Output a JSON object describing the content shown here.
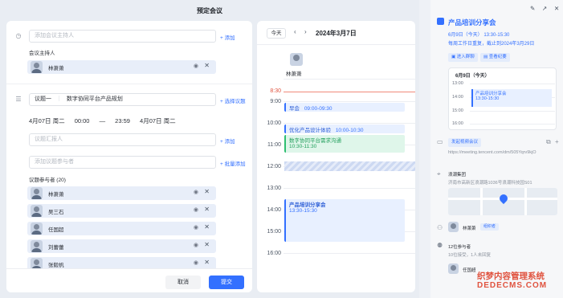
{
  "dialog": {
    "title": "预定会议"
  },
  "form": {
    "host_placeholder": "添加会议主持人",
    "add_label": "添加",
    "host_section_label": "会议主持人",
    "host": {
      "name": "林萧萧"
    },
    "topic_tag": "议题一",
    "topic_value": "数字协同平台产品规划",
    "select_topic": "选择议题",
    "time": {
      "start_date": "4月07日 周二",
      "start_time": "00:00",
      "dash": "—",
      "end_time": "23:59",
      "end_date": "4月07日 周二"
    },
    "reporter_placeholder": "议题汇报人",
    "participant_placeholder": "添加议题参与者",
    "batch_add": "批量添加",
    "participants_label": "议题参与者 (20)",
    "participants": [
      {
        "name": "林萧萧"
      },
      {
        "name": "吴三石"
      },
      {
        "name": "任国超"
      },
      {
        "name": "刘蕾蕾"
      },
      {
        "name": "张毅帆"
      }
    ],
    "cancel": "取消",
    "submit": "提交"
  },
  "calendar": {
    "today": "今天",
    "prev": "‹",
    "next": "›",
    "date": "2024年3月7日",
    "person": "林萧萧",
    "now": "8:30",
    "hours": [
      "9:00",
      "10:00",
      "11:00",
      "12:00",
      "13:00",
      "14:00",
      "15:00",
      "16:00"
    ],
    "events": [
      {
        "title": "早会",
        "time": "09:00-09:30"
      },
      {
        "title": "优化产品设计体验",
        "time": "10:00-10:30"
      },
      {
        "title": "数字协同平台需求沟通",
        "time": "10:30-11:30"
      },
      {
        "title": "产品培训分享会",
        "time": "13:30-15:30"
      }
    ]
  },
  "panel": {
    "title": "产品培训分享会",
    "when": "6月9日（今天） 13:30-15:30",
    "repeat": "每周工作日重复，截止到2024年3月29日",
    "chip_join": "进入群聊",
    "chip_minutes": "查看纪要",
    "mini_header": "6月9日（今天）",
    "mini_hours": [
      "13:00",
      "14:00",
      "15:00",
      "16:00"
    ],
    "mini_event": "产品培训分享会",
    "mini_event_time": "13:30-15:30",
    "meeting_btn": "发起视频会议",
    "meeting_url": "https://meeting.tencent.com/dm/505Yqrv9kjO",
    "location": "浪潮集团",
    "address": "济南市高新区浪潮路1036号浪潮科技园S01",
    "organizer": "林萧萧",
    "organizer_tag": "组织者",
    "attendees": "12位参与者",
    "attendees_sub": "10位接受，1人未回复",
    "attendee_first": "任国超"
  },
  "watermark": {
    "line1": "织梦内容管理系统",
    "line2": "DEDECMS.COM"
  },
  "colors": {
    "accent": "#3370ff",
    "now_line": "#e0533f",
    "green_event": "#2fbf71"
  }
}
